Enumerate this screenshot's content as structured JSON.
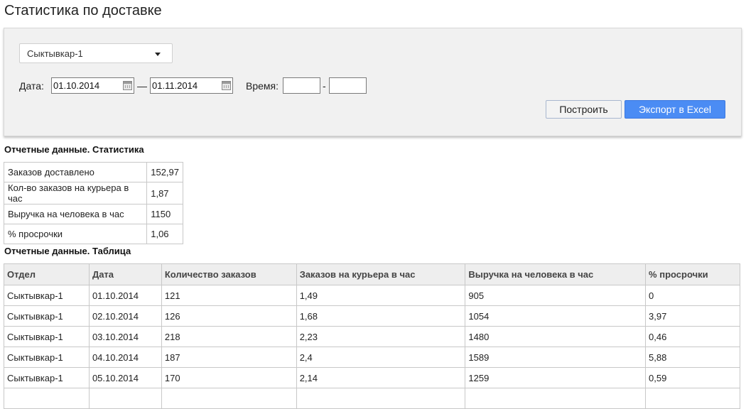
{
  "page_title": "Статистика по доставке",
  "filters": {
    "department": "Сыктывкар-1",
    "date_label": "Дата:",
    "date_from": "01.10.2014",
    "date_separator": "—",
    "date_to": "01.11.2014",
    "time_label": "Время:",
    "time_from": "",
    "time_separator": "-",
    "time_to": "",
    "build_button": "Построить",
    "export_button": "Экспорт в Excel"
  },
  "stats": {
    "title": "Отчетные данные. Статистика",
    "rows": [
      {
        "label": "Заказов доставлено",
        "value": "152,97"
      },
      {
        "label": "Кол-во заказов на курьера в час",
        "value": "1,87"
      },
      {
        "label": "Выручка на человека в час",
        "value": "1150"
      },
      {
        "label": "% просрочки",
        "value": "1,06"
      }
    ]
  },
  "table": {
    "title": "Отчетные данные. Таблица",
    "columns": [
      "Отдел",
      "Дата",
      "Количество заказов",
      "Заказов на курьера в час",
      "Выручка на человека в час",
      "% просрочки"
    ],
    "rows": [
      [
        "Сыктывкар-1",
        "01.10.2014",
        "121",
        "1,49",
        "905",
        "0"
      ],
      [
        "Сыктывкар-1",
        "02.10.2014",
        "126",
        "1,68",
        "1054",
        "3,97"
      ],
      [
        "Сыктывкар-1",
        "03.10.2014",
        "218",
        "2,23",
        "1480",
        "0,46"
      ],
      [
        "Сыктывкар-1",
        "04.10.2014",
        "187",
        "2,4",
        "1589",
        "5,88"
      ],
      [
        "Сыктывкар-1",
        "05.10.2014",
        "170",
        "2,14",
        "1259",
        "0,59"
      ],
      [
        "",
        "",
        "",
        "",
        "",
        ""
      ]
    ]
  },
  "colors": {
    "export_button": "#4b8cf4",
    "panel_background": "#f1f1f1",
    "table_header_background": "#eeeeee"
  }
}
